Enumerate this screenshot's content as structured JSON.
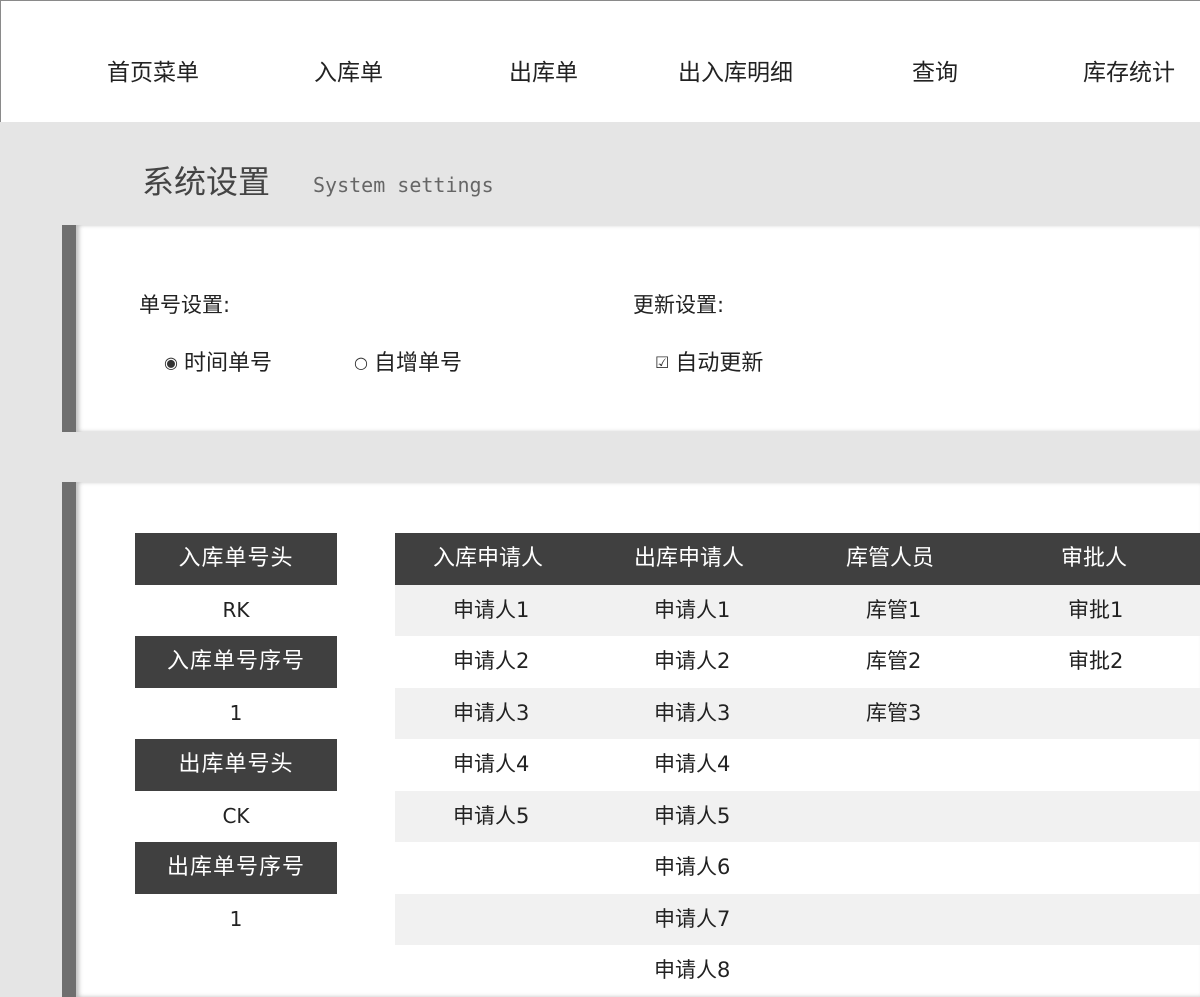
{
  "nav": {
    "items": [
      "首页菜单",
      "入库单",
      "出库单",
      "出入库明细",
      "查询",
      "库存统计"
    ]
  },
  "header": {
    "title": "系统设置",
    "subtitle": "System settings"
  },
  "settings": {
    "number_label": "单号设置:",
    "options": {
      "time_number": {
        "label": "时间单号",
        "checked": true
      },
      "auto_increment": {
        "label": "自增单号",
        "checked": false
      }
    },
    "update_label": "更新设置:",
    "auto_update": {
      "label": "自动更新",
      "checked": true
    },
    "marks": {
      "radio_on": "◉",
      "radio_off": "○",
      "checkbox_on": "☑"
    }
  },
  "number_config": [
    {
      "label": "入库单号头",
      "value": "RK"
    },
    {
      "label": "入库单号序号",
      "value": "1"
    },
    {
      "label": "出库单号头",
      "value": "CK"
    },
    {
      "label": "出库单号序号",
      "value": "1"
    }
  ],
  "people_table": {
    "columns": [
      "入库申请人",
      "出库申请人",
      "库管人员",
      "审批人"
    ],
    "rows": [
      [
        "申请人1",
        "申请人1",
        "库管1",
        "审批1"
      ],
      [
        "申请人2",
        "申请人2",
        "库管2",
        "审批2"
      ],
      [
        "申请人3",
        "申请人3",
        "库管3",
        ""
      ],
      [
        "申请人4",
        "申请人4",
        "",
        ""
      ],
      [
        "申请人5",
        "申请人5",
        "",
        ""
      ],
      [
        "",
        "申请人6",
        "",
        ""
      ],
      [
        "",
        "申请人7",
        "",
        ""
      ],
      [
        "",
        "申请人8",
        "",
        ""
      ]
    ]
  },
  "colors": {
    "header_dark": "#404040",
    "row_shade": "#f1f1f1",
    "page_bg": "#e5e5e5"
  }
}
